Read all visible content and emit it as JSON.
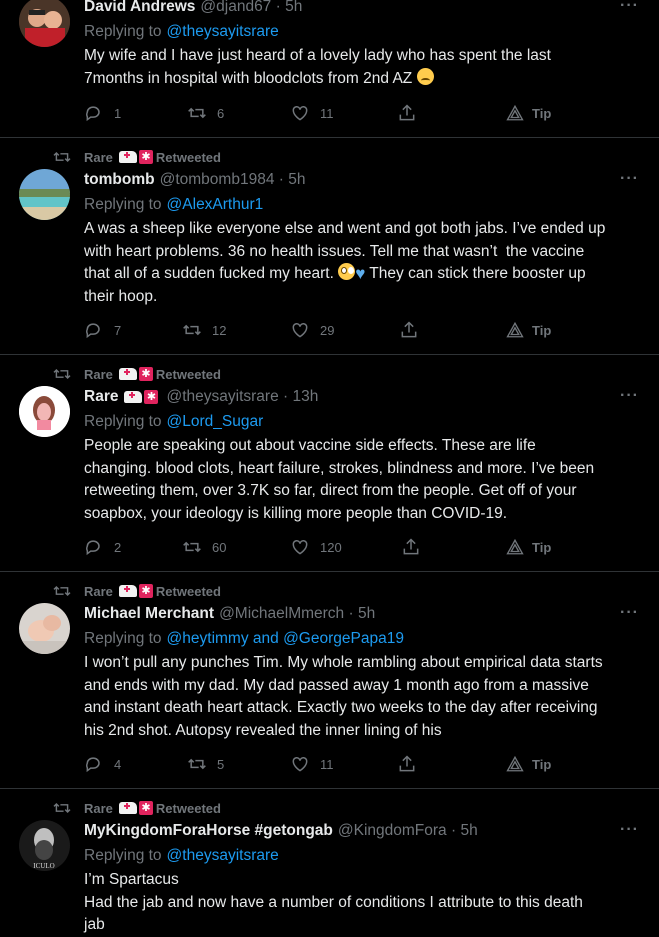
{
  "tweets": [
    {
      "name": "David Andrews",
      "handle": "@djand67 · 5h",
      "replying_label": "Replying to",
      "replying_to": "@theysayitsrare",
      "text": "My wife and I have just heard of a lovely lady who has spent the last\n7months in hospital with bloodclots from 2nd AZ ",
      "emoji": "sad-face",
      "replies": "1",
      "retweets": "6",
      "likes": "11",
      "tip": "Tip"
    },
    {
      "retweeted_by": "Rare",
      "retweeted_label": "Retweeted",
      "name": "tombomb",
      "handle": "@tombomb1984 · 5h",
      "replying_label": "Replying to",
      "replying_to": "@AlexArthur1",
      "text": "A was a sheep like everyone else and went and got both jabs. I’ve ended up\nwith heart problems. 36 no health issues. Tell me that wasn’t  the vaccine\nthat all of a sudden fucked my heart. ",
      "text_tail": " They can stick there booster up\ntheir hoop.",
      "replies": "7",
      "retweets": "12",
      "likes": "29",
      "tip": "Tip"
    },
    {
      "retweeted_by": "Rare",
      "retweeted_label": "Retweeted",
      "name": "Rare",
      "handle": "@theysayitsrare · 13h",
      "replying_label": "Replying to",
      "replying_to": "@Lord_Sugar",
      "text": "People are speaking out about vaccine side effects. These are life\nchanging. blood clots, heart failure, strokes, blindness and more. I’ve been\nretweeting them, over 3.7K so far, direct from the people. Get off of your\nsoapbox, your ideology is killing more people than COVID-19.",
      "replies": "2",
      "retweets": "60",
      "likes": "120",
      "tip": "Tip"
    },
    {
      "retweeted_by": "Rare",
      "retweeted_label": "Retweeted",
      "name": "Michael Merchant",
      "handle": "@MichaelMmerch · 5h",
      "replying_label": "Replying to",
      "replying_to": "@heytimmy and @GeorgePapa19",
      "text": "I won’t pull any punches Tim. My whole rambling about empirical data starts\nand ends with my dad. My dad passed away 1 month ago from a massive\nand instant death heart attack. Exactly two weeks to the day after receiving\nhis 2nd shot. Autopsy revealed the inner lining of his",
      "replies": "4",
      "retweets": "5",
      "likes": "11",
      "tip": "Tip"
    },
    {
      "retweeted_by": "Rare",
      "retweeted_label": "Retweeted",
      "name": "MyKingdomForaHorse #getongab",
      "handle": "@KingdomFora · 5h",
      "replying_label": "Replying to",
      "replying_to": "@theysayitsrare",
      "text": "I’m Spartacus\nHad the jab and now have a number of conditions I attribute to this death\njab",
      "avatar_text": "ICULO"
    }
  ],
  "more_menu": "···"
}
